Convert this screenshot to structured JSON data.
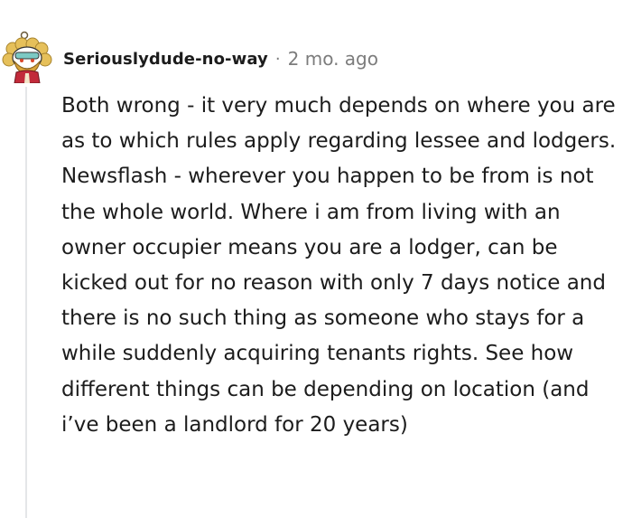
{
  "comment": {
    "username": "Seriouslydude-no-way",
    "separator": "·",
    "time": "2 mo. ago",
    "paragraphs": [
      "Both wrong - it very much depends on where you are as to which rules apply regarding lessee and lodgers.",
      "Newsflash - wherever you happen to be from is not the whole world. Where i am from living with an owner occupier means you are a lodger, can be kicked out for no reason with only 7 days notice and there is no such thing as someone who stays for a while suddenly acquiring tenants rights. See how different things can be depending on location (and i’ve been a landlord for 20 years)"
    ]
  },
  "colors": {
    "text": "#1c1c1c",
    "meta": "#7c7c7c",
    "thread_line": "#e4e6e8"
  },
  "icons": {
    "avatar": "snoo-avatar-icon"
  }
}
